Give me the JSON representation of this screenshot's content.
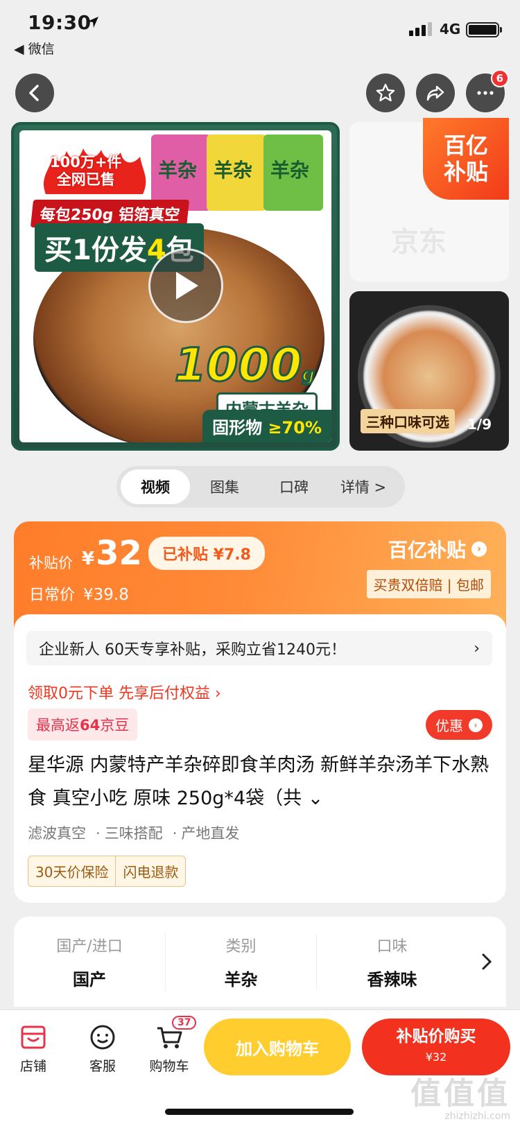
{
  "status_bar": {
    "time": "19:30",
    "back_app": "◀ 微信",
    "network": "4G"
  },
  "header": {
    "cart_badge_count": "6"
  },
  "gallery": {
    "hero": {
      "sold_line1": "100万+件",
      "sold_line2": "全网已售",
      "package_info": "每包250g 铝箔真空",
      "buy_prefix": "买1份发",
      "buy_count": "4",
      "buy_suffix": "包",
      "weight_num": "1000",
      "weight_unit": "g",
      "origin_tag": "内蒙古羊杂",
      "solid_label": "固形物",
      "solid_value": "≥70%",
      "package_label": "羊杂"
    },
    "side_badge_line1": "百亿",
    "side_badge_line2": "补贴",
    "side_watermark": "京东",
    "thumb_caption": "三种口味可选",
    "thumb_count": "1/9"
  },
  "tabs": [
    {
      "label": "视频",
      "active": true
    },
    {
      "label": "图集",
      "active": false
    },
    {
      "label": "口碑",
      "active": false
    },
    {
      "label": "详情 >",
      "active": false
    }
  ],
  "price": {
    "subsidy_label": "补贴价",
    "currency": "¥",
    "subsidy_price": "32",
    "subsidized_text": "已补贴 ¥7.8",
    "daily_label": "日常价",
    "daily_price": "¥39.8",
    "program_name": "百亿补贴",
    "guarantee": "买贵双倍赔 | 包邮"
  },
  "info": {
    "notice": "企业新人 60天专享补贴，采购立省1240元！",
    "pay_later": "领取0元下单 先享后付权益 ›",
    "bean_prefix": "最高返",
    "bean_count": "64",
    "bean_suffix": "京豆",
    "promo_label": "优惠",
    "title": "星华源 内蒙特产羊杂碎即食羊肉汤 新鲜羊杂汤羊下水熟食 真空小吃 原味 250g*4袋（共",
    "features": [
      "滤波真空",
      "三味搭配",
      "产地直发"
    ],
    "warranty": [
      "30天价保险",
      "闪电退款"
    ]
  },
  "attributes": [
    {
      "key": "国产/进口",
      "value": "国产"
    },
    {
      "key": "类别",
      "value": "羊杂"
    },
    {
      "key": "口味",
      "value": "香辣味"
    }
  ],
  "bottom_bar": {
    "store": "店铺",
    "service": "客服",
    "cart": "购物车",
    "cart_count": "37",
    "add_to_cart": "加入购物车",
    "buy_label": "补贴价购买",
    "buy_price": "¥32"
  },
  "watermark": {
    "big": "值值值",
    "small": "zhizhizhi.com"
  }
}
